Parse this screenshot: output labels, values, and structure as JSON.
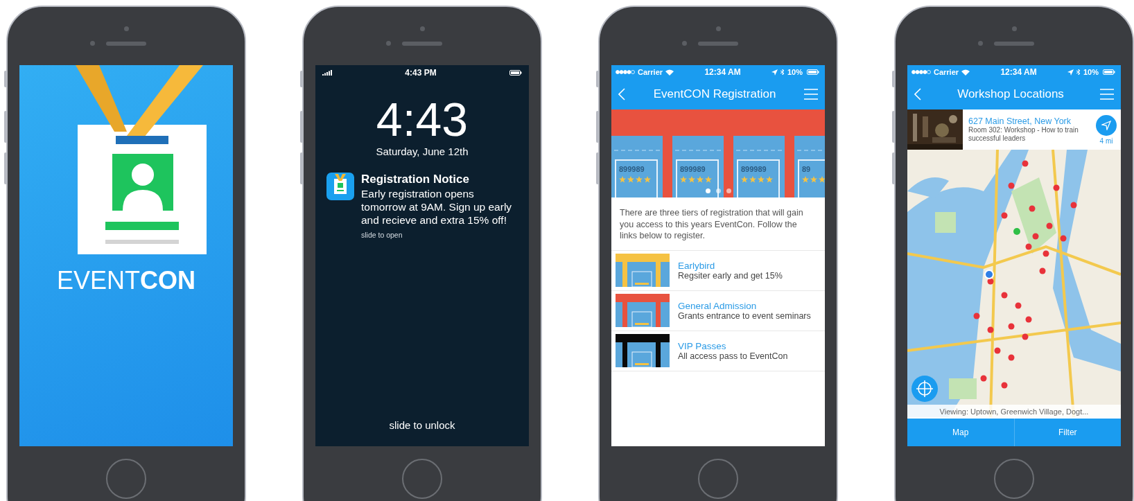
{
  "phones": [
    {
      "kind": "splash",
      "logo_light": "EVENT",
      "logo_bold": "CON"
    },
    {
      "kind": "lock",
      "status_time": "4:43 PM",
      "clock": "4:43",
      "date": "Saturday, June 12th",
      "notification": {
        "title": "Registration Notice",
        "body": "Early registration opens tomorrow at 9AM. Sign up early and recieve and extra 15% off!",
        "action": "slide to open"
      },
      "unlock": "slide to unlock"
    },
    {
      "kind": "registration",
      "status": {
        "carrier": "Carrier",
        "time": "12:34 AM",
        "battery": "10%"
      },
      "title": "EventCON Registration",
      "tickets": [
        "899989",
        "899989",
        "899989",
        "89"
      ],
      "pages": [
        {
          "selected": true
        },
        {
          "selected": false
        },
        {
          "selected": false
        }
      ],
      "intro": "There are three tiers of registration that will gain you access to this years EventCon. Follow the links below to register.",
      "tiers": [
        {
          "name": "Earlybird",
          "description": "Regsiter early and get 15%",
          "color": "#f5c243"
        },
        {
          "name": "General Admission",
          "description": "Grants entrance to event seminars",
          "color": "#e8523f"
        },
        {
          "name": "VIP Passes",
          "description": "All access pass to EventCon",
          "color": "#0a0a0a"
        }
      ]
    },
    {
      "kind": "map",
      "status": {
        "carrier": "Carrier",
        "time": "12:34 AM",
        "battery": "10%"
      },
      "title": "Workshop Locations",
      "location": {
        "address": "627 Main Street, New York",
        "details": "Room 302: Workshop - How to train successful leaders",
        "distance": "4 mi"
      },
      "viewing": "Viewing: Uptown, Greenwich Village, Dogt...",
      "tabs": [
        "Map",
        "Filter"
      ]
    }
  ]
}
